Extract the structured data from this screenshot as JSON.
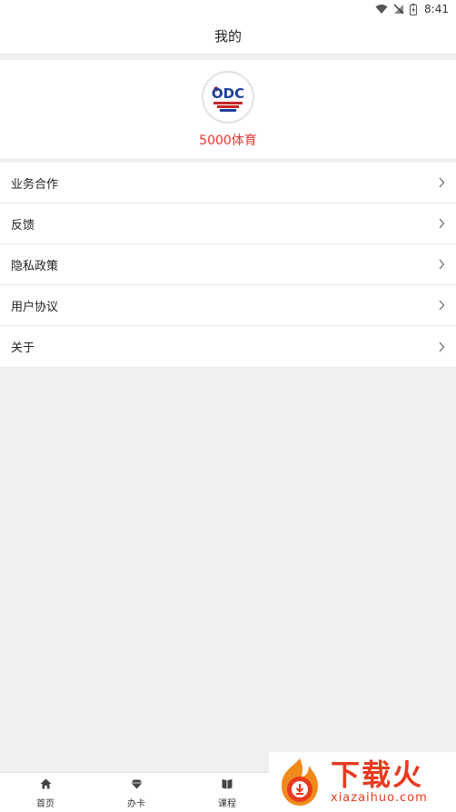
{
  "status_bar": {
    "time": "8:41",
    "icons": [
      "wifi-icon",
      "no-signal-icon",
      "battery-icon"
    ]
  },
  "header": {
    "title": "我的"
  },
  "profile": {
    "name": "5000体育",
    "avatar_icon": "brand-logo-icon",
    "name_color": "#e53935"
  },
  "menu": {
    "items": [
      {
        "label": "业务合作",
        "icon": "chevron-right-icon"
      },
      {
        "label": "反馈",
        "icon": "chevron-right-icon"
      },
      {
        "label": "隐私政策",
        "icon": "chevron-right-icon"
      },
      {
        "label": "用户协议",
        "icon": "chevron-right-icon"
      },
      {
        "label": "关于",
        "icon": "chevron-right-icon"
      }
    ]
  },
  "bottom_nav": {
    "items": [
      {
        "label": "首页",
        "icon": "home-icon"
      },
      {
        "label": "办卡",
        "icon": "diamond-icon"
      },
      {
        "label": "课程",
        "icon": "book-icon"
      }
    ]
  },
  "watermark": {
    "title": "下载火",
    "subtitle": "xiazaihuo.com",
    "color": "#e83a1f"
  }
}
